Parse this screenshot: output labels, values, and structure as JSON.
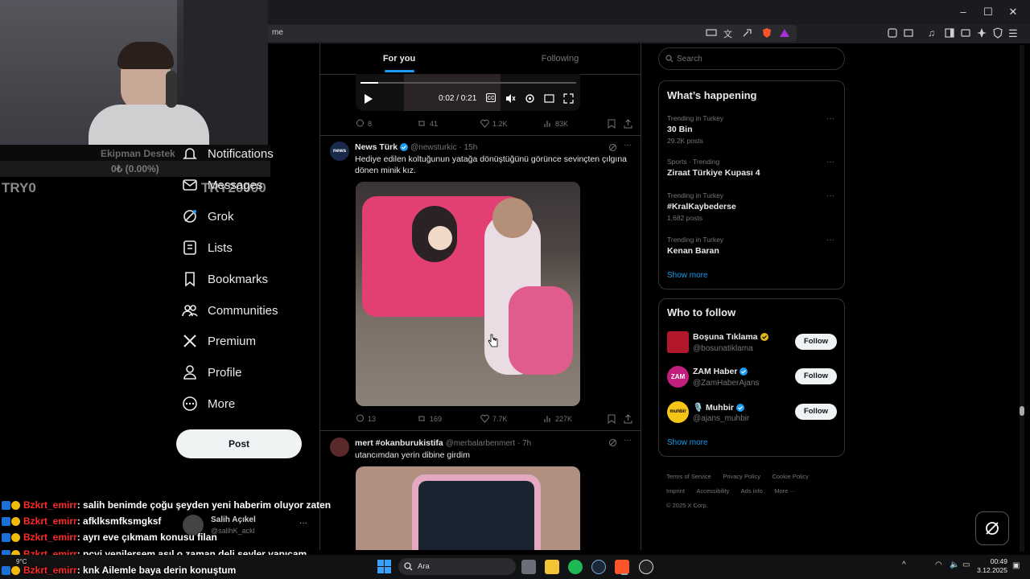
{
  "browser": {
    "address_fragment": "me",
    "window_controls": [
      "minimize-icon",
      "maximize-icon",
      "close-icon"
    ]
  },
  "stream_overlay": {
    "goal_label": "Ekipman Destek",
    "goal_progress": "0₺ (0.00%)",
    "goal_start": "TRY0",
    "goal_target": "TRY20000"
  },
  "nav": {
    "items": [
      {
        "label": "Notifications",
        "icon": "bell-icon"
      },
      {
        "label": "Messages",
        "icon": "mail-icon"
      },
      {
        "label": "Grok",
        "icon": "grok-icon"
      },
      {
        "label": "Lists",
        "icon": "list-icon"
      },
      {
        "label": "Bookmarks",
        "icon": "bookmark-icon"
      },
      {
        "label": "Communities",
        "icon": "people-icon"
      },
      {
        "label": "Premium",
        "icon": "x-logo-icon"
      },
      {
        "label": "Profile",
        "icon": "person-icon"
      },
      {
        "label": "More",
        "icon": "more-circle-icon"
      }
    ],
    "post_label": "Post"
  },
  "feed": {
    "tabs": {
      "for_you": "For you",
      "following": "Following"
    },
    "video_player": {
      "time": "0:02 / 0:21"
    },
    "tweet0_actions": {
      "replies": "8",
      "reposts": "41",
      "likes": "1.2K",
      "views": "83K"
    },
    "tweet1": {
      "name": "News Türk",
      "handle": "@newsturkic",
      "time": "· 15h",
      "avatar_text": "news",
      "text": "Hediye edilen koltuğunun yatağa dönüştüğünü görünce sevinçten çılgına dönen minik kız.",
      "replies": "13",
      "reposts": "169",
      "likes": "7.7K",
      "views": "227K"
    },
    "tweet2": {
      "name": "mert #okanburukistifa",
      "handle": "@merbalarbenmert",
      "time": "· 7h",
      "text": "utancımdan yerin dibine girdim"
    }
  },
  "right": {
    "search_placeholder": "Search",
    "whats_happening_title": "What’s happening",
    "trends": [
      {
        "category": "Trending in Turkey",
        "name": "30 Bin",
        "count": "29.2K posts"
      },
      {
        "category": "Sports · Trending",
        "name": "Ziraat Türkiye Kupası 4",
        "count": ""
      },
      {
        "category": "Trending in Turkey",
        "name": "#KralKaybederse",
        "count": "1,682 posts"
      },
      {
        "category": "Trending in Turkey",
        "name": "Kenan Baran",
        "count": ""
      }
    ],
    "show_more": "Show more",
    "who_to_follow_title": "Who to follow",
    "follow_suggestions": [
      {
        "name": "Boşuna Tıklama",
        "handle": "@bosunatiklama",
        "button": "Follow"
      },
      {
        "name": "ZAM Haber",
        "handle": "@ZamHaberAjans",
        "button": "Follow",
        "avatar_text": "ZAM"
      },
      {
        "name": "🎙️ Muhbir",
        "handle": "@ajans_muhbir",
        "button": "Follow",
        "avatar_text": "muhbir"
      }
    ],
    "show_more_2": "Show more",
    "footer": [
      "Terms of Service",
      "Privacy Policy",
      "Cookie Policy",
      "Imprint",
      "Accessibility",
      "Ads info",
      "More ···",
      "© 2025 X Corp."
    ]
  },
  "account_preview": {
    "name": "Salih Açıkel",
    "handle": "@salihK_ackl"
  },
  "chat": [
    {
      "user": "Bzkrt_emirr",
      "message": ": salih benimde çoğu şeyden yeni haberim oluyor zaten"
    },
    {
      "user": "Bzkrt_emirr",
      "message": ": afklksmfksmgksf"
    },
    {
      "user": "Bzkrt_emirr",
      "message": ": ayrı eve çıkmam konusu filan"
    },
    {
      "user": "Bzkrt_emirr",
      "message": ": pcyi yenilersem asıl o zaman deli şeyler yapıcam"
    },
    {
      "user": "Bzkrt_emirr",
      "message": ": knk Ailemle baya derin konuştum"
    }
  ],
  "taskbar": {
    "search_placeholder": "Ara",
    "weather": "9°C",
    "time": "00:49",
    "date": "3.12.2025"
  },
  "colors": {
    "accent": "#1d9bf0",
    "chat_name": "#ff2a2a",
    "verified": "#1d9bf0",
    "gold": "#e2b719"
  }
}
